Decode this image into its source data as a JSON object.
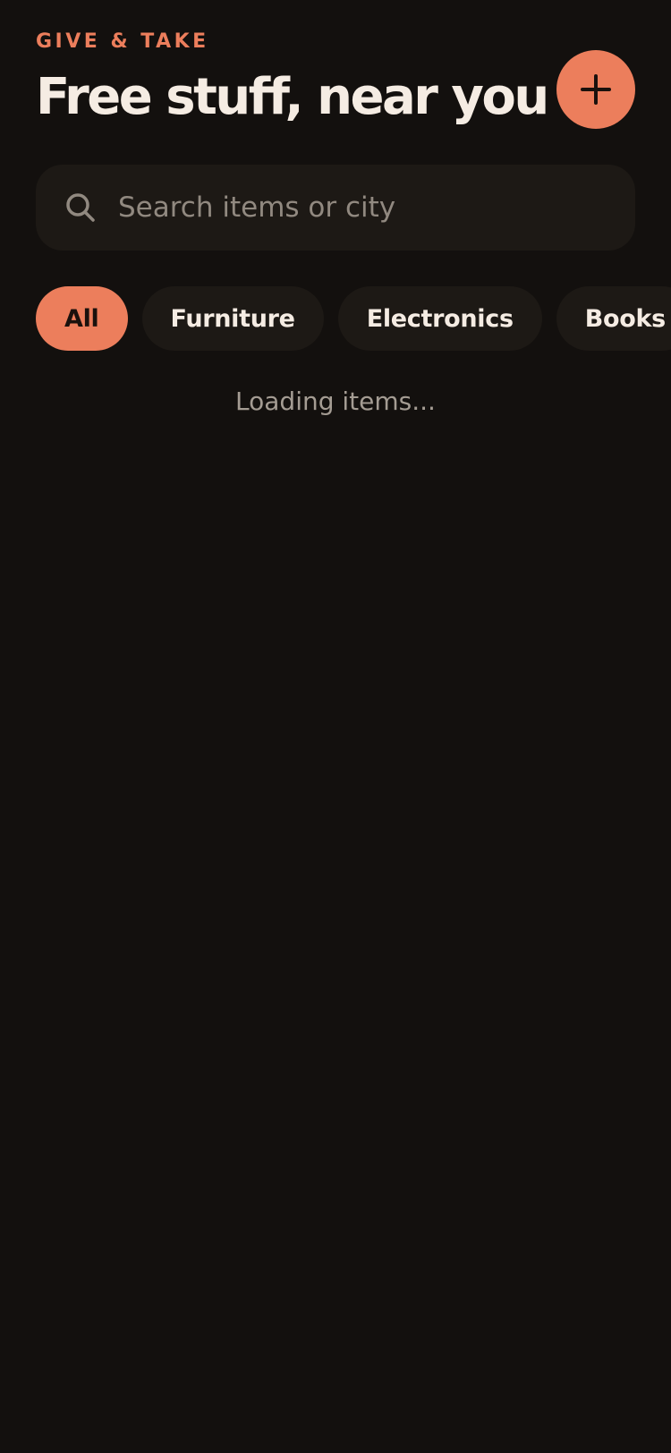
{
  "header": {
    "eyebrow": "GIVE & TAKE",
    "title": "Free stuff, near you",
    "add_icon": "plus-icon"
  },
  "search": {
    "value": "",
    "placeholder": "Search items or city",
    "icon": "search-icon"
  },
  "categories": {
    "selected": "All",
    "items": [
      {
        "label": "All"
      },
      {
        "label": "Furniture"
      },
      {
        "label": "Electronics"
      },
      {
        "label": "Books"
      }
    ]
  },
  "status": {
    "loading_text": "Loading items..."
  },
  "colors": {
    "background": "#13100e",
    "surface": "#1d1915",
    "accent": "#ec7e5c",
    "text": "#f5ece3",
    "muted": "#a49c93"
  }
}
